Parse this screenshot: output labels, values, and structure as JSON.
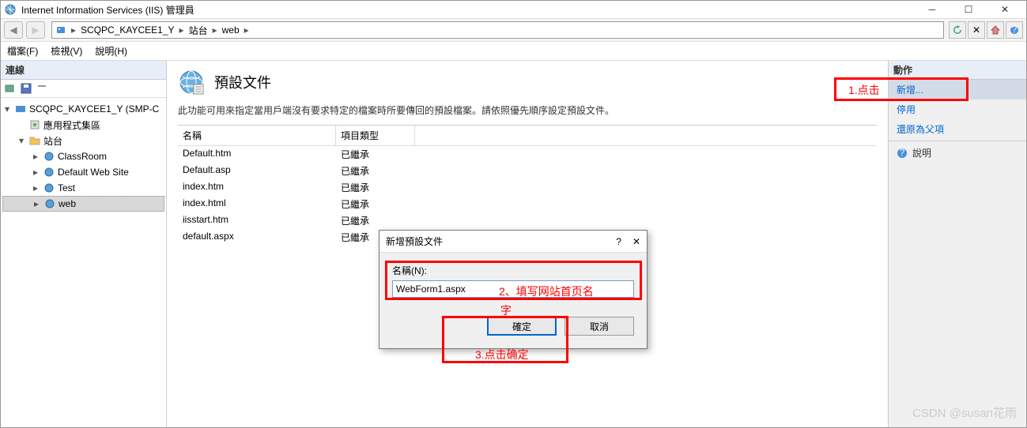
{
  "window": {
    "title": "Internet Information Services (IIS) 管理員"
  },
  "breadcrumb": {
    "parts": [
      "SCQPC_KAYCEE1_Y",
      "站台",
      "web"
    ]
  },
  "menu": {
    "file": "檔案(F)",
    "view": "檢視(V)",
    "help": "說明(H)"
  },
  "left": {
    "header": "連線",
    "root": "SCQPC_KAYCEE1_Y (SMP-C",
    "pool": "應用程式集區",
    "sites": "站台",
    "siteList": [
      "ClassRoom",
      "Default Web Site",
      "Test",
      "web"
    ]
  },
  "main": {
    "title": "預設文件",
    "desc": "此功能可用來指定當用戶端沒有要求特定的檔案時所要傳回的預設檔案。請依照優先順序設定預設文件。",
    "col1": "名稱",
    "col2": "項目類型",
    "rows": [
      {
        "name": "Default.htm",
        "type": "已繼承"
      },
      {
        "name": "Default.asp",
        "type": "已繼承"
      },
      {
        "name": "index.htm",
        "type": "已繼承"
      },
      {
        "name": "index.html",
        "type": "已繼承"
      },
      {
        "name": "iisstart.htm",
        "type": "已繼承"
      },
      {
        "name": "default.aspx",
        "type": "已繼承"
      }
    ]
  },
  "actions": {
    "header": "動作",
    "add": "新增...",
    "disable": "停用",
    "revert": "還原為父項",
    "help": "說明"
  },
  "dialog": {
    "title": "新增預設文件",
    "label": "名稱(N):",
    "value": "WebForm1.aspx",
    "ok": "確定",
    "cancel": "取消"
  },
  "annotations": {
    "a1": "1.点击",
    "a2": "2、填写网站首页名",
    "a2b": "字",
    "a3": "3.点击确定"
  },
  "watermark": "CSDN @susan花雨"
}
